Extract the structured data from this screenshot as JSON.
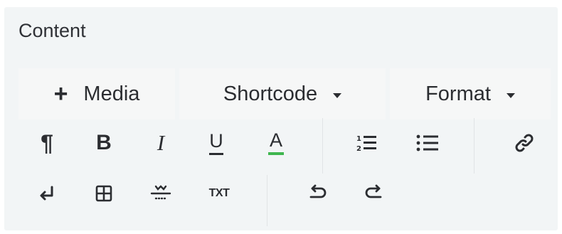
{
  "section": {
    "title": "Content"
  },
  "toolbar": {
    "media_label": "Media",
    "shortcode_label": "Shortcode",
    "format_label": "Format",
    "bold_glyph": "B",
    "italic_glyph": "I",
    "underline_glyph": "U",
    "font_color_glyph": "A",
    "text_glyph": "TXT",
    "pilcrow_glyph": "¶",
    "font_color_accent": "#3fb64f"
  }
}
